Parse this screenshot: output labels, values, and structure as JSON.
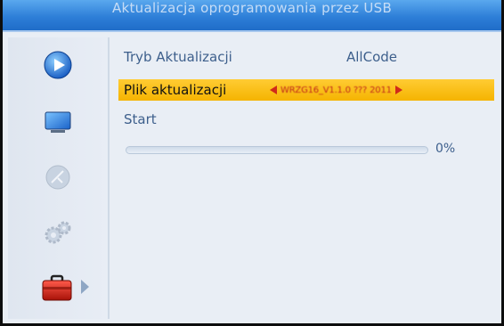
{
  "title": "Aktualizacja oprogramowania przez USB",
  "sidebar": {
    "items": [
      {
        "icon": "play-icon"
      },
      {
        "icon": "tv-screen-icon"
      },
      {
        "icon": "satellite-dish-icon"
      },
      {
        "icon": "gears-icon"
      },
      {
        "icon": "toolbox-icon",
        "active": true
      }
    ]
  },
  "menu": {
    "update_mode_label": "Tryb Aktualizacji",
    "update_mode_value": "AllCode",
    "update_file_label": "Plik aktualizacji",
    "update_file_value": "WRZG16_V1.1.0 ??? 2011",
    "start_label": "Start"
  },
  "progress": {
    "value": 0,
    "text": "0%"
  },
  "colors": {
    "title_bar": "#2e7fd8",
    "selection": "#f5b400",
    "text": "#3d5f8c",
    "file_arrows": "#d02a1a"
  }
}
